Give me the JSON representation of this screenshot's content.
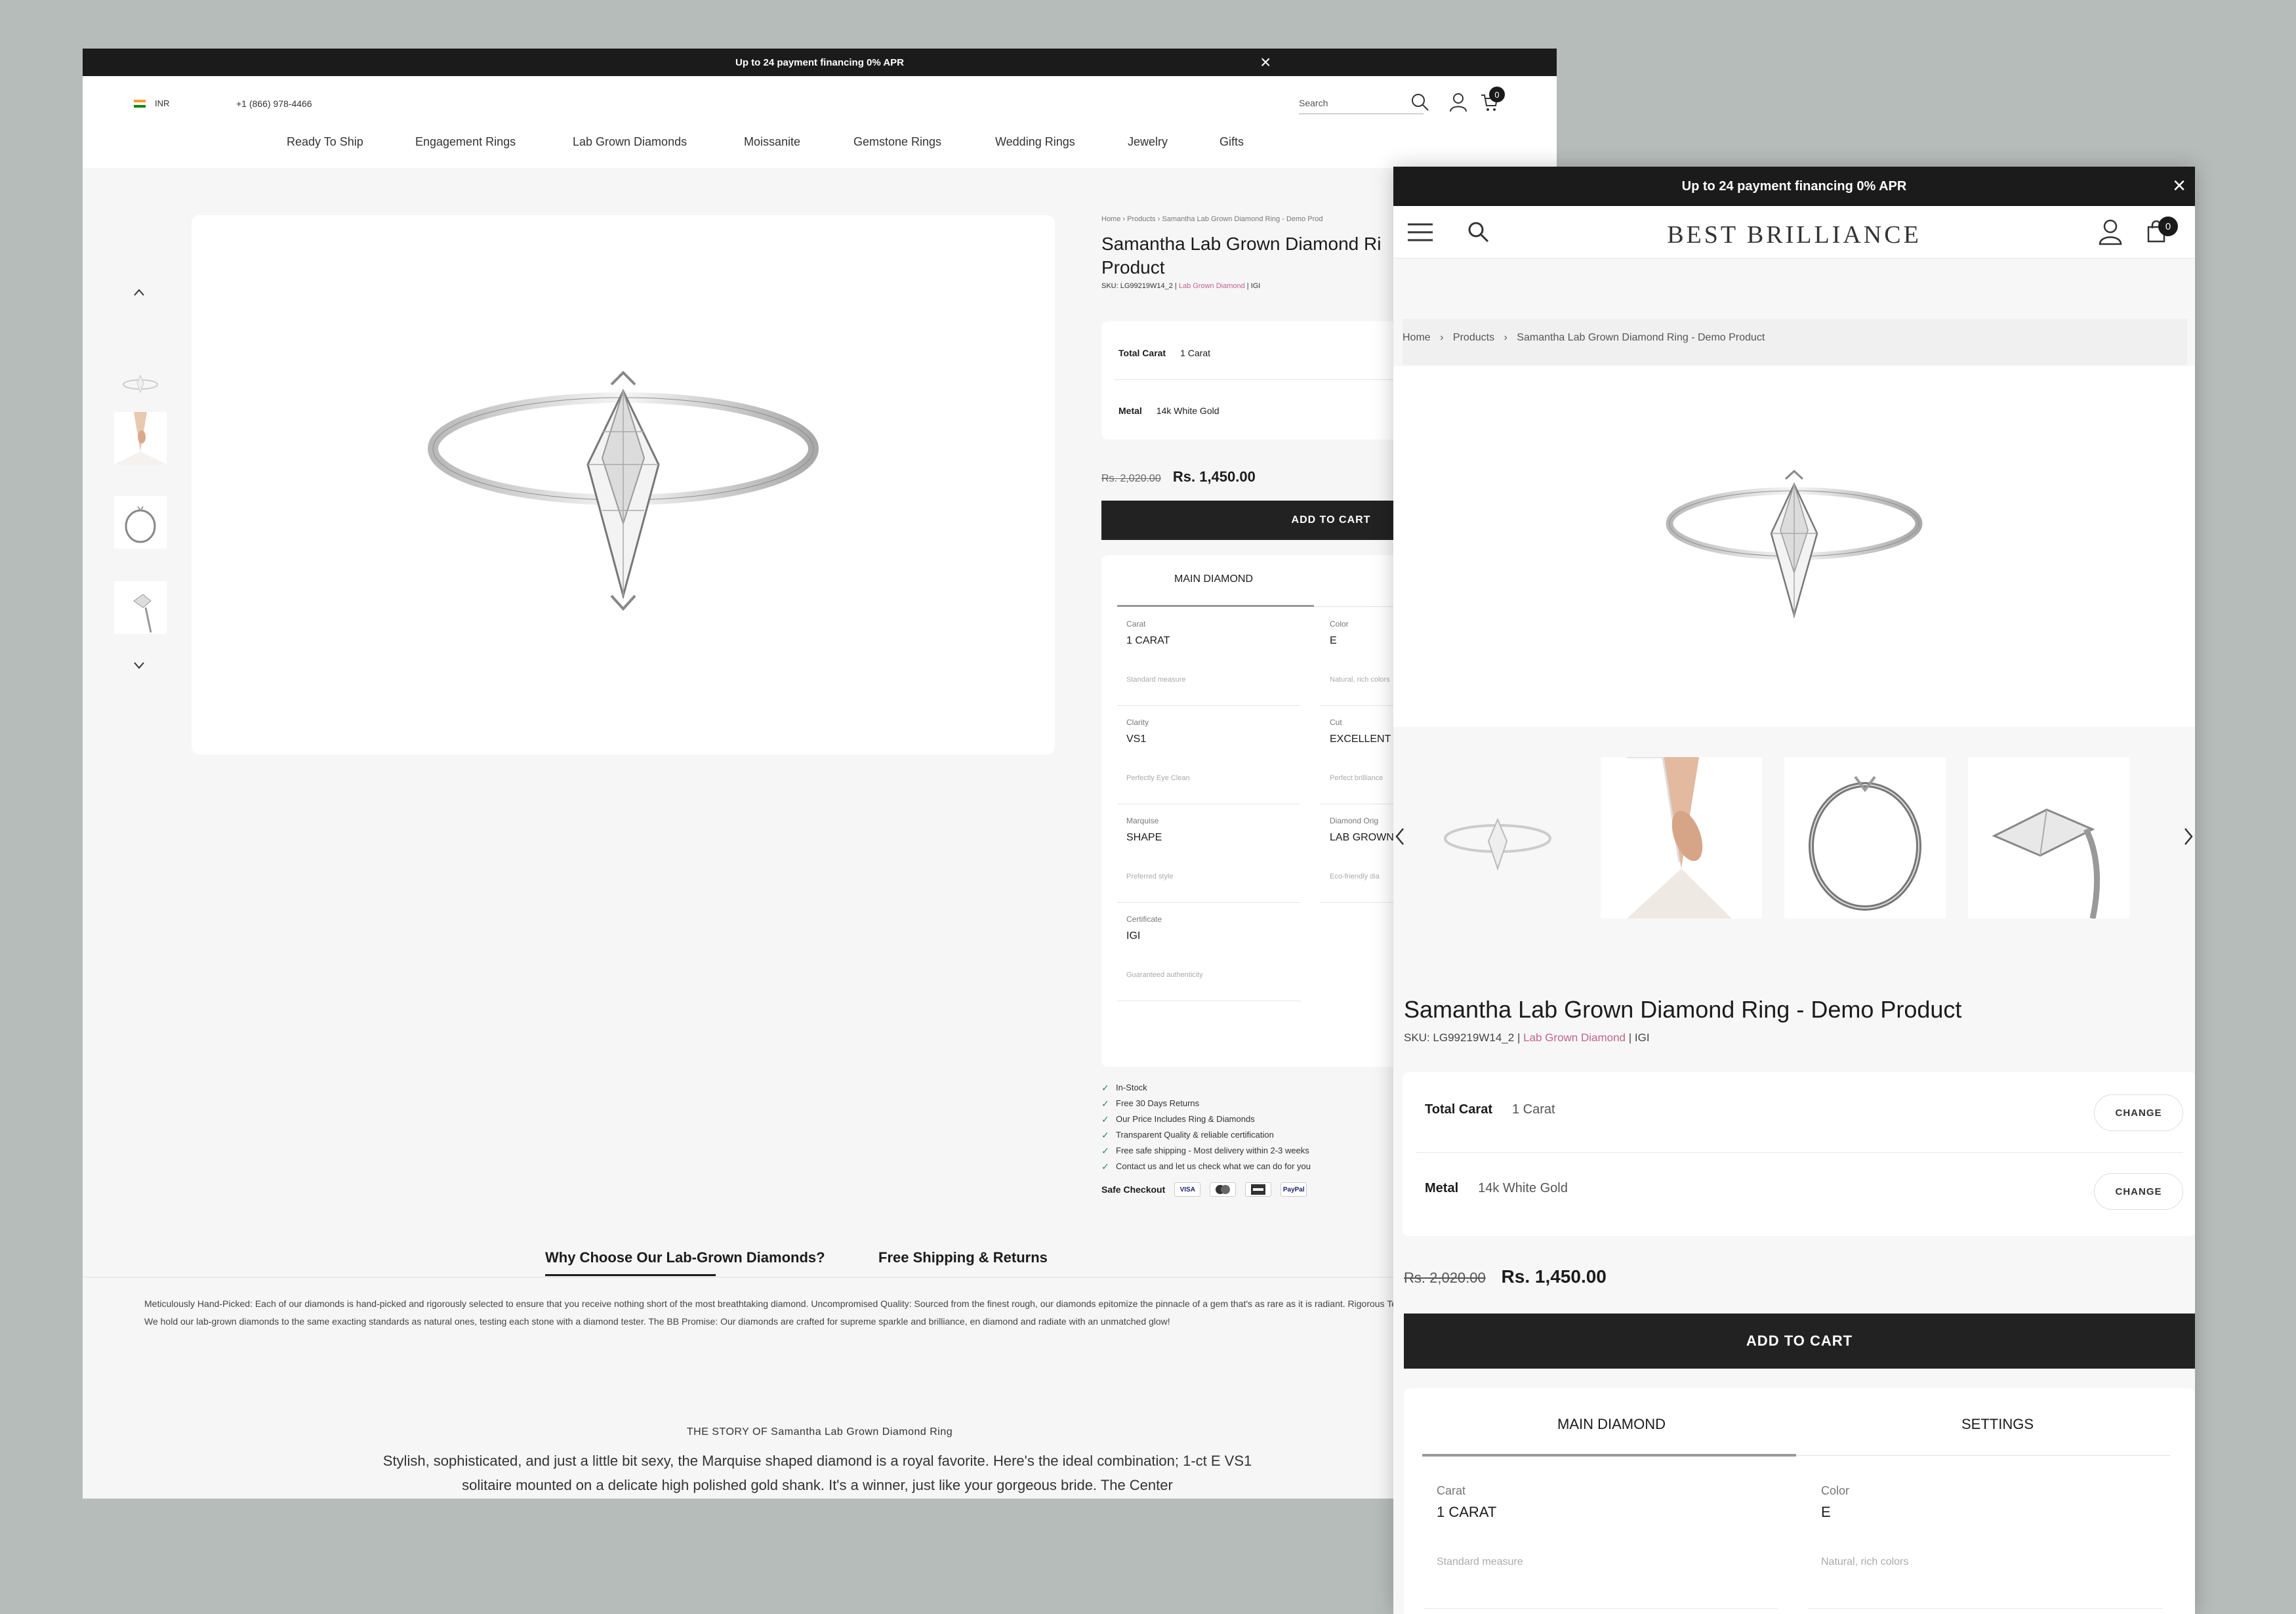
{
  "desktop": {
    "announcement": "Up to 24 payment financing 0% APR",
    "currency": "INR",
    "phone": "+1 (866) 978-4466",
    "search_placeholder": "Search",
    "cart_count": "0",
    "nav": [
      "Ready To Ship",
      "Engagement Rings",
      "Lab Grown Diamonds",
      "Moissanite",
      "Gemstone Rings",
      "Wedding Rings",
      "Jewelry",
      "Gifts"
    ],
    "breadcrumb": [
      "Home",
      "Products",
      "Samantha Lab Grown Diamond Ring - Demo Prod"
    ],
    "title_line1": "Samantha Lab Grown Diamond Ri",
    "title_line2": "Product",
    "sku": "SKU: LG99219W14_2 |",
    "sku_type": "Lab Grown Diamond",
    "sku_cert": "| IGI",
    "options": [
      {
        "label": "Total Carat",
        "value": "1 Carat"
      },
      {
        "label": "Metal",
        "value": "14k White Gold"
      }
    ],
    "price_old": "Rs. 2,020.00",
    "price_new": "Rs. 1,450.00",
    "add_to_cart": "ADD TO CART",
    "tabs": [
      "MAIN DIAMOND",
      "SE"
    ],
    "specs": [
      {
        "label": "Carat",
        "value": "1 CARAT",
        "hint": "Standard measure"
      },
      {
        "label": "Color",
        "value": "E",
        "hint": "Natural, rich colors"
      },
      {
        "label": "Clarity",
        "value": "VS1",
        "hint": "Perfectly Eye Clean"
      },
      {
        "label": "Cut",
        "value": "EXCELLENT",
        "hint": "Perfect brilliance"
      },
      {
        "label": "Marquise",
        "value": "SHAPE",
        "hint": "Preferred style"
      },
      {
        "label": "Diamond Orig",
        "value": "LAB GROWN",
        "hint": "Eco-friendly dia"
      },
      {
        "label": "Certificate",
        "value": "IGI",
        "hint": "Guaranteed authenticity"
      }
    ],
    "features": [
      "In-Stock",
      "Free 30 Days Returns",
      "Our Price Includes Ring & Diamonds",
      "Transparent Quality & reliable certification",
      "Free safe shipping - Most delivery within 2-3 weeks",
      "Contact us and let us check what we can do for you"
    ],
    "safe_checkout": "Safe Checkout",
    "payments": [
      "VISA",
      "MC",
      "AMEX",
      "PayPal"
    ],
    "bottom_tabs": [
      "Why Choose Our Lab-Grown Diamonds?",
      "Free Shipping & Returns"
    ],
    "description": "Meticulously Hand-Picked: Each of our diamonds is hand-picked and rigorously selected to ensure that you receive nothing short of the most breathtaking diamond. Uncompromised Quality: Sourced from the finest rough, our diamonds epitomize the pinnacle of a gem that's as rare as it is radiant. Rigorous Testing: We hold our lab-grown diamonds to the same exacting standards as natural ones, testing each stone with a diamond tester. The BB Promise: Our diamonds are crafted for supreme sparkle and brilliance, en diamond and radiate with an unmatched glow!",
    "story_heading": "THE STORY OF Samantha Lab Grown Diamond Ring",
    "story_text": "Stylish, sophisticated, and just a little bit sexy, the Marquise shaped diamond is a royal favorite. Here's the ideal combination; 1-ct E VS1 solitaire mounted on a delicate high polished gold shank. It's a winner, just like your gorgeous bride. The Center"
  },
  "mobile": {
    "announcement": "Up to 24 payment financing 0% APR",
    "logo": "BEST BRILLIANCE",
    "cart_count": "0",
    "breadcrumb": [
      "Home",
      "Products",
      "Samantha Lab Grown Diamond Ring - Demo Product"
    ],
    "title": "Samantha Lab Grown Diamond Ring - Demo Product",
    "sku": "SKU: LG99219W14_2 |",
    "sku_type": "Lab Grown Diamond",
    "sku_cert": "| IGI",
    "options": [
      {
        "label": "Total Carat",
        "value": "1 Carat",
        "action": "CHANGE"
      },
      {
        "label": "Metal",
        "value": "14k White Gold",
        "action": "CHANGE"
      }
    ],
    "price_old": "Rs. 2,020.00",
    "price_new": "Rs. 1,450.00",
    "add_to_cart": "ADD TO CART",
    "tabs": [
      "MAIN DIAMOND",
      "SETTINGS"
    ],
    "specs": [
      {
        "label": "Carat",
        "value": "1 CARAT",
        "hint": "Standard measure"
      },
      {
        "label": "Color",
        "value": "E",
        "hint": "Natural, rich colors"
      }
    ]
  }
}
